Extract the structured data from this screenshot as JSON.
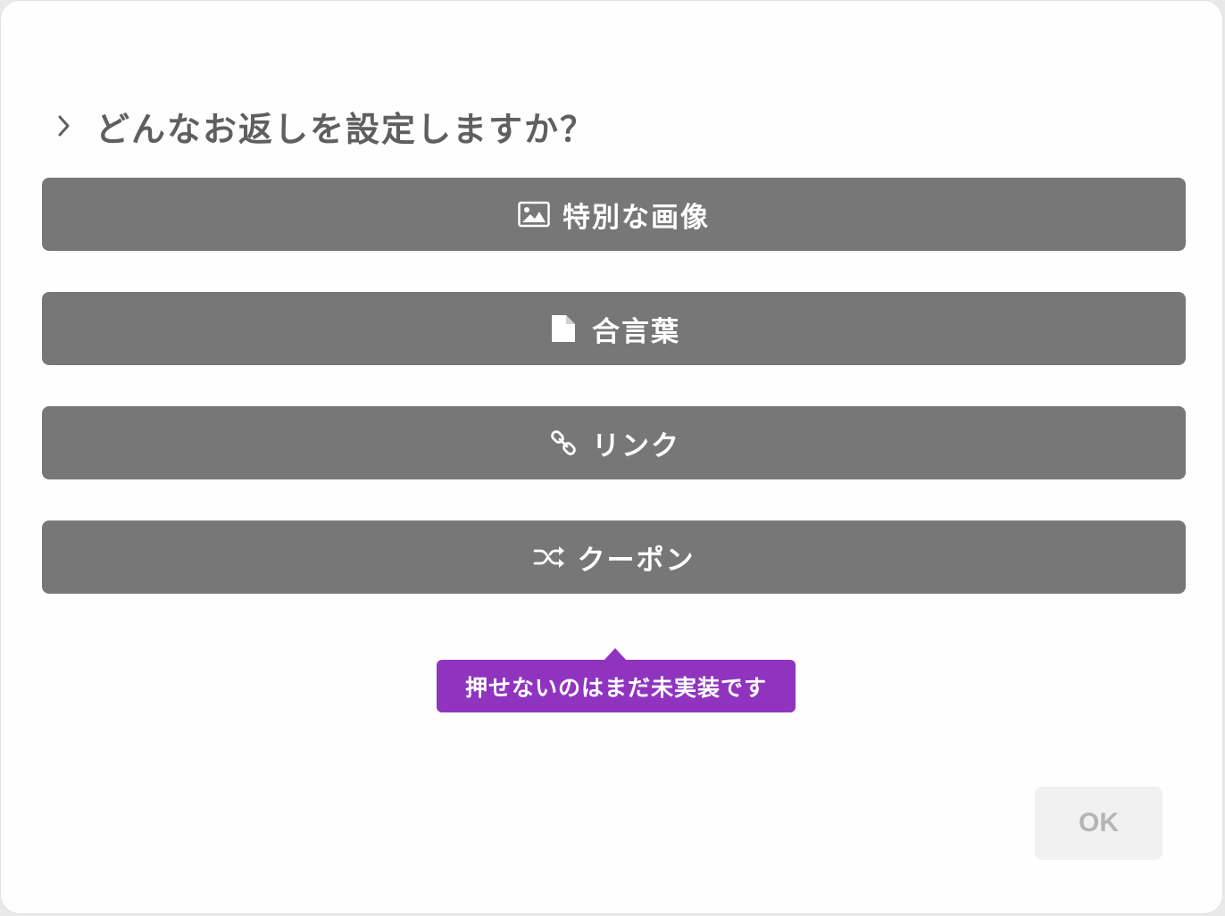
{
  "dialog": {
    "title": "どんなお返しを設定しますか？",
    "options": [
      {
        "label": "特別な画像",
        "icon": "image-icon"
      },
      {
        "label": "合言葉",
        "icon": "document-icon"
      },
      {
        "label": "リンク",
        "icon": "link-icon"
      },
      {
        "label": "クーポン",
        "icon": "shuffle-icon"
      }
    ],
    "tooltip": "押せないのはまだ未実装です",
    "ok_label": "OK"
  },
  "colors": {
    "option_bg": "#777777",
    "tooltip_bg": "#9034c0",
    "title_text": "#5f5f5f",
    "ok_bg": "#f1f1f1",
    "ok_text": "#b5b5b5"
  }
}
